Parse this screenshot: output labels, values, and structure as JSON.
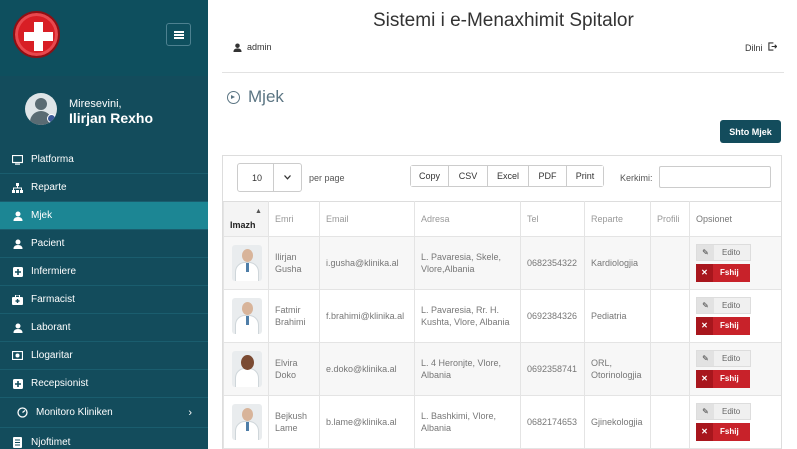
{
  "sidebar": {
    "welcome": "Miresevini,",
    "username": "Ilirjan Rexho",
    "items": [
      {
        "label": "Platforma",
        "icon": "desktop-icon",
        "active": false
      },
      {
        "label": "Reparte",
        "icon": "sitemap-icon",
        "active": false
      },
      {
        "label": "Mjek",
        "icon": "user-md-icon",
        "active": true
      },
      {
        "label": "Pacient",
        "icon": "user-icon",
        "active": false
      },
      {
        "label": "Infermiere",
        "icon": "plus-square-icon",
        "active": false
      },
      {
        "label": "Farmacist",
        "icon": "medkit-icon",
        "active": false
      },
      {
        "label": "Laborant",
        "icon": "user-icon",
        "active": false
      },
      {
        "label": "Llogaritar",
        "icon": "money-icon",
        "active": false
      },
      {
        "label": "Recepsionist",
        "icon": "plus-square-icon",
        "active": false
      },
      {
        "label": "Monitoro Kliniken",
        "icon": "dashboard-icon",
        "active": false
      },
      {
        "label": "Njoftimet",
        "icon": "document-icon",
        "active": false
      }
    ]
  },
  "header": {
    "title": "Sistemi i e-Menaxhimit Spitalor",
    "user": "admin",
    "logout": "Dilni"
  },
  "page": {
    "title": "Mjek",
    "add_button": "Shto Mjek"
  },
  "table_controls": {
    "per_page_value": "10",
    "per_page_label": "per page",
    "export_buttons": [
      "Copy",
      "CSV",
      "Excel",
      "PDF",
      "Print"
    ],
    "search_label": "Kerkimi:",
    "search_value": ""
  },
  "table": {
    "columns": [
      "Imazh",
      "Emri",
      "Email",
      "Adresa",
      "Tel",
      "Reparte",
      "Profili",
      "Opsionet"
    ],
    "rows": [
      {
        "name": "Ilirjan Gusha",
        "email": "i.gusha@klinika.al",
        "address": "L. Pavaresia, Skele, Vlore,Albania",
        "tel": "0682354322",
        "department": "Kardiologjia",
        "profile": "",
        "gender": "m"
      },
      {
        "name": "Fatmir Brahimi",
        "email": "f.brahimi@klinika.al",
        "address": "L. Pavaresia, Rr. H. Kushta, Vlore, Albania",
        "tel": "0692384326",
        "department": "Pediatria",
        "profile": "",
        "gender": "m"
      },
      {
        "name": "Elvira Doko",
        "email": "e.doko@klinika.al",
        "address": "L. 4 Heronjte, Vlore, Albania",
        "tel": "0692358741",
        "department": "ORL, Otorinologjia",
        "profile": "",
        "gender": "f"
      },
      {
        "name": "Bejkush Lame",
        "email": "b.lame@klinika.al",
        "address": "L. Bashkimi, Vlore, Albania",
        "tel": "0682174653",
        "department": "Gjinekologjia",
        "profile": "",
        "gender": "m"
      }
    ],
    "edit_label": "Edito",
    "delete_label": "Fshij"
  },
  "colors": {
    "sidebar": "#134c5c",
    "active": "#1c8694",
    "danger": "#c8222a"
  }
}
